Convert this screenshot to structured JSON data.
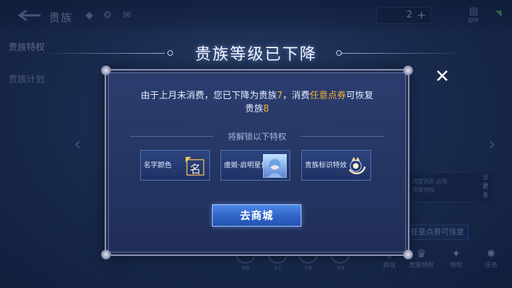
{
  "header": {
    "title": "贵族",
    "currency_value": "2",
    "mail_label": "邮件"
  },
  "sidebar": {
    "items": [
      {
        "label": "贵族特权"
      },
      {
        "label": "贵族计划"
      }
    ]
  },
  "background": {
    "card_text": [
      "鸿蒙洞天·启程",
      "贵族特权"
    ],
    "more_label": [
      "更",
      "多"
    ],
    "restore_button": "任意点券可恢复",
    "levels": [
      "V6",
      "V7",
      "V8",
      "V9"
    ],
    "bottom_items": [
      "商城",
      "贵族特权",
      "特权",
      "任务"
    ]
  },
  "dialog": {
    "title": "贵族等级已下降",
    "message": {
      "part1": "由于上月未消费，您已下降为贵族",
      "current_level": "7",
      "part2": "，消费",
      "highlight": "任意点券",
      "part3": "可恢复",
      "line2_prefix": "贵族",
      "restore_level": "8"
    },
    "unlock_title": "将解锁以下特权",
    "perks": [
      {
        "label": "名字颜色",
        "icon": "name-color-icon"
      },
      {
        "label": "虞姬·启明星使",
        "icon": "skin-portrait-icon"
      },
      {
        "label": "贵族标识特效",
        "icon": "noble-badge-icon"
      }
    ],
    "shop_button": "去商城",
    "close_icon": "close-icon"
  },
  "colors": {
    "accent": "#f5b236",
    "button": "#2f63c6",
    "frame": "#8e95b4"
  }
}
